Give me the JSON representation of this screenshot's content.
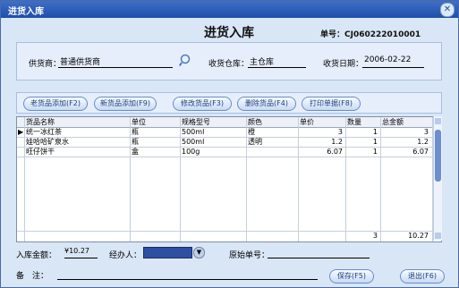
{
  "window": {
    "title": "进货入库",
    "close_icon": "close-icon"
  },
  "form": {
    "title": "进货入库",
    "doc_no_label": "单号：",
    "doc_no": "CJ060222010001",
    "supplier_label": "供货商：",
    "supplier_value": "普通供货商",
    "warehouse_label": "收货仓库：",
    "warehouse_value": "主仓库",
    "date_label": "收货日期：",
    "date_value": "2006-02-22"
  },
  "toolbar": {
    "add_old": "老货品添加(F2)",
    "add_new": "新货品添加(F9)",
    "edit": "修改货品(F3)",
    "delete": "删除货品(F4)",
    "print": "打印单据(F8)"
  },
  "table": {
    "headers": [
      "货品名称",
      "单位",
      "规格型号",
      "颜色",
      "单价",
      "数量",
      "总金额"
    ],
    "rows": [
      {
        "name": "统一冰红茶",
        "unit": "瓶",
        "spec": "500ml",
        "color": "橙",
        "price": "3",
        "qty": "1",
        "total": "3"
      },
      {
        "name": "娃哈哈矿泉水",
        "unit": "瓶",
        "spec": "500ml",
        "color": "透明",
        "price": "1.2",
        "qty": "1",
        "total": "1.2"
      },
      {
        "name": "旺仔饼干",
        "unit": "盒",
        "spec": "100g",
        "color": "",
        "price": "6.07",
        "qty": "1",
        "total": "6.07"
      }
    ],
    "footer": {
      "qty": "3",
      "total": "10.27"
    }
  },
  "footer": {
    "amount_label": "入库金额：",
    "amount_value": "¥10.27",
    "handler_label": "经办人：",
    "original_label": "原始单号：",
    "remark_label": "备　注：",
    "save": "保存(F5)",
    "exit": "退出(F6)"
  }
}
